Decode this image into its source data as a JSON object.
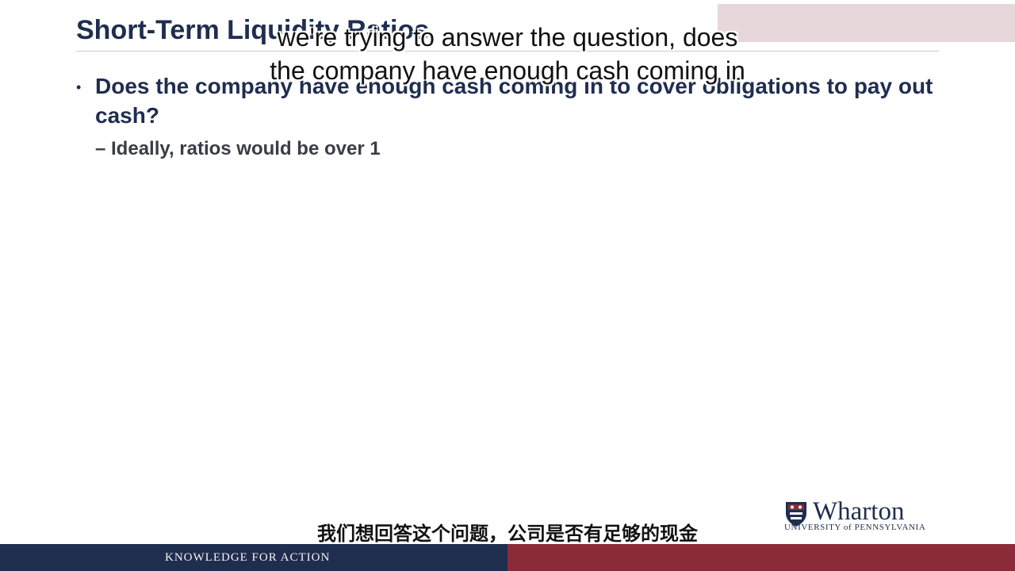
{
  "slide": {
    "title": "Short-Term Liquidity Ratios",
    "bullet": "Does the company have enough cash coming in to cover obligations to pay out cash?",
    "sub_bullet": "– Ideally, ratios would be over 1",
    "bullet_marker": "•"
  },
  "captions": {
    "english_line_1": "we're trying to answer the question, does",
    "english_line_2": "the company have enough cash coming in",
    "chinese": "我们想回答这个问题，公司是否有足够的现金"
  },
  "footer": {
    "tagline": "KNOWLEDGE FOR ACTION"
  },
  "logo": {
    "name": "Wharton",
    "subtitle": "UNIVERSITY of PENNSYLVANIA"
  },
  "colors": {
    "navy": "#1f2d4f",
    "maroon": "#8b2a39",
    "pink_band": "#e7d7db"
  }
}
